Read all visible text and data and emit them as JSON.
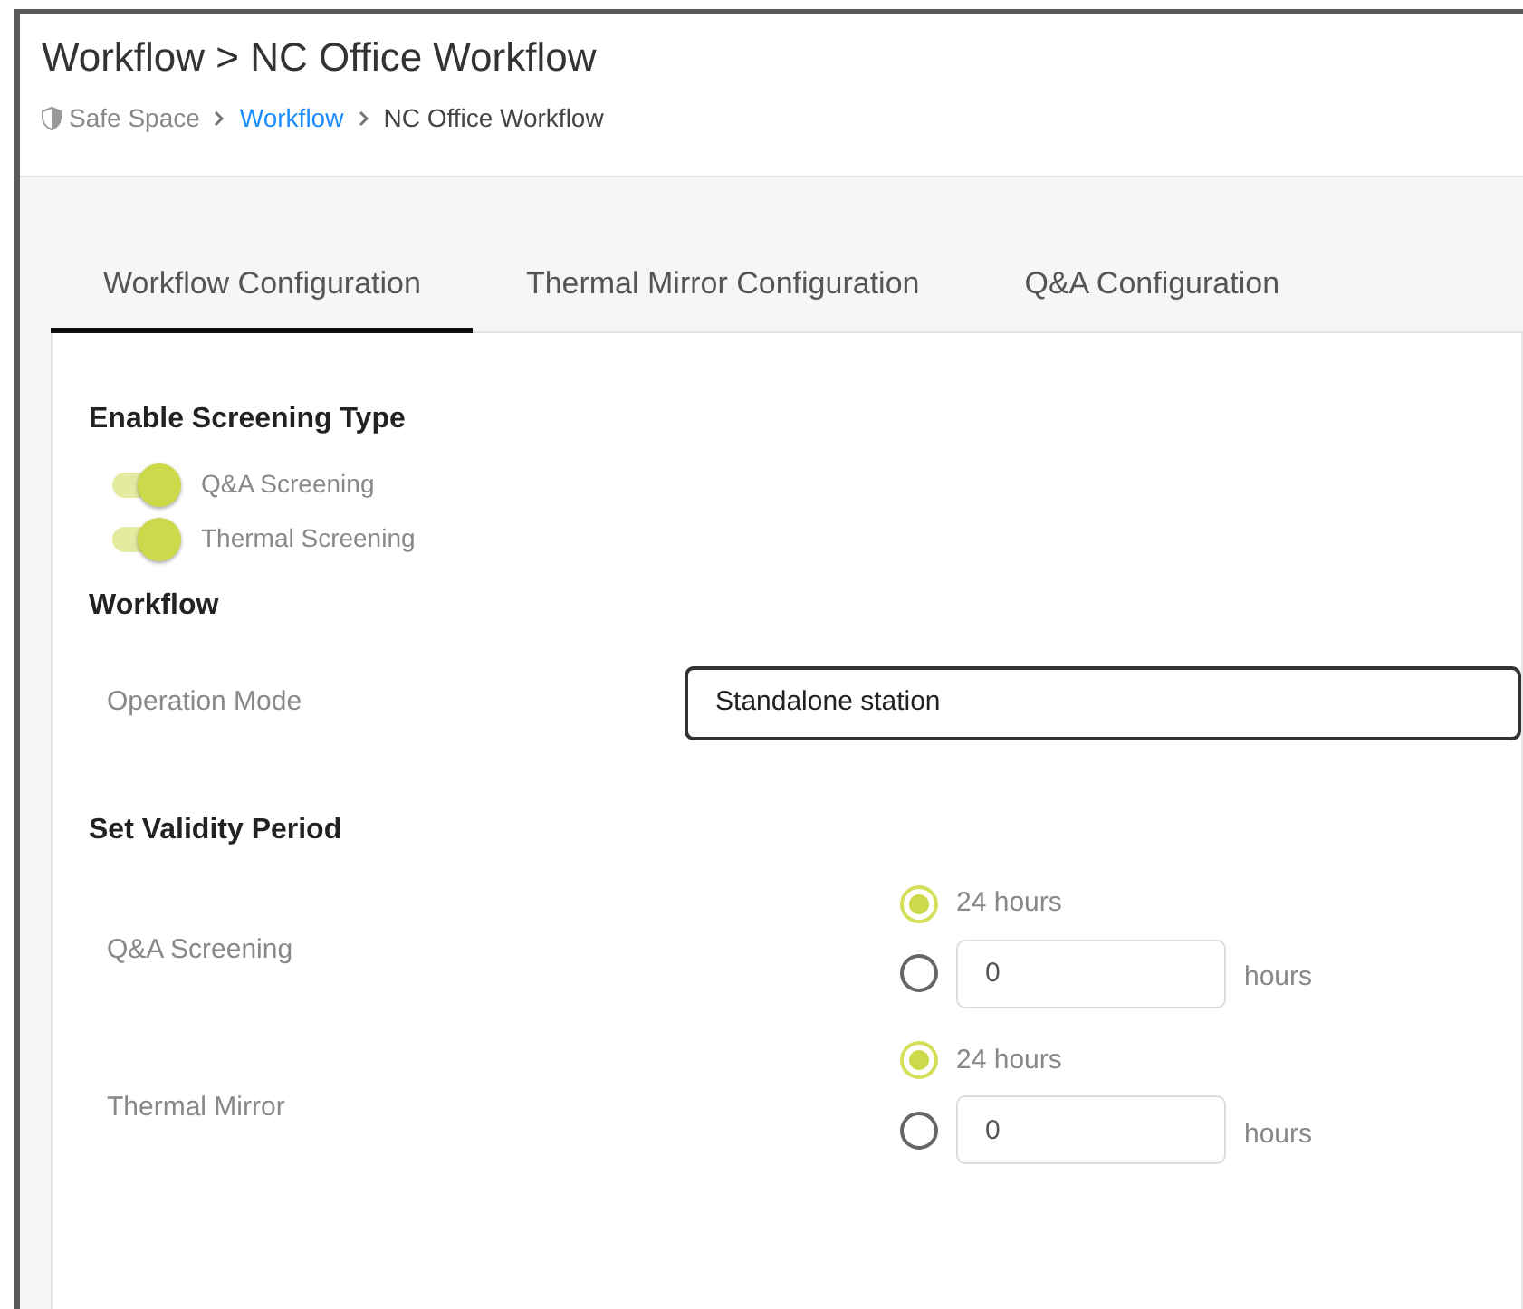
{
  "header": {
    "title": "Workflow > NC Office Workflow",
    "breadcrumb": [
      {
        "label": "Safe Space",
        "kind": "home"
      },
      {
        "label": "Workflow",
        "kind": "link"
      },
      {
        "label": "NC Office Workflow",
        "kind": "current"
      }
    ]
  },
  "tabs": [
    {
      "label": "Workflow Configuration",
      "selected": true
    },
    {
      "label": "Thermal Mirror Configuration",
      "selected": false
    },
    {
      "label": "Q&A Configuration",
      "selected": false
    }
  ],
  "screening": {
    "heading": "Enable Screening Type",
    "toggles": [
      {
        "label": "Q&A Screening",
        "on": true
      },
      {
        "label": "Thermal Screening",
        "on": true
      }
    ]
  },
  "workflow": {
    "heading": "Workflow",
    "operation_mode": {
      "label": "Operation Mode",
      "value": "Standalone station"
    }
  },
  "validity": {
    "heading": "Set Validity Period",
    "rows": [
      {
        "label": "Q&A Screening",
        "options": [
          {
            "kind": "preset",
            "label": "24 hours",
            "selected": true
          },
          {
            "kind": "custom",
            "value": "0",
            "unit": "hours",
            "selected": false
          }
        ]
      },
      {
        "label": "Thermal Mirror",
        "options": [
          {
            "kind": "preset",
            "label": "24 hours",
            "selected": true
          },
          {
            "kind": "custom",
            "value": "0",
            "unit": "hours",
            "selected": false
          }
        ]
      }
    ]
  }
}
